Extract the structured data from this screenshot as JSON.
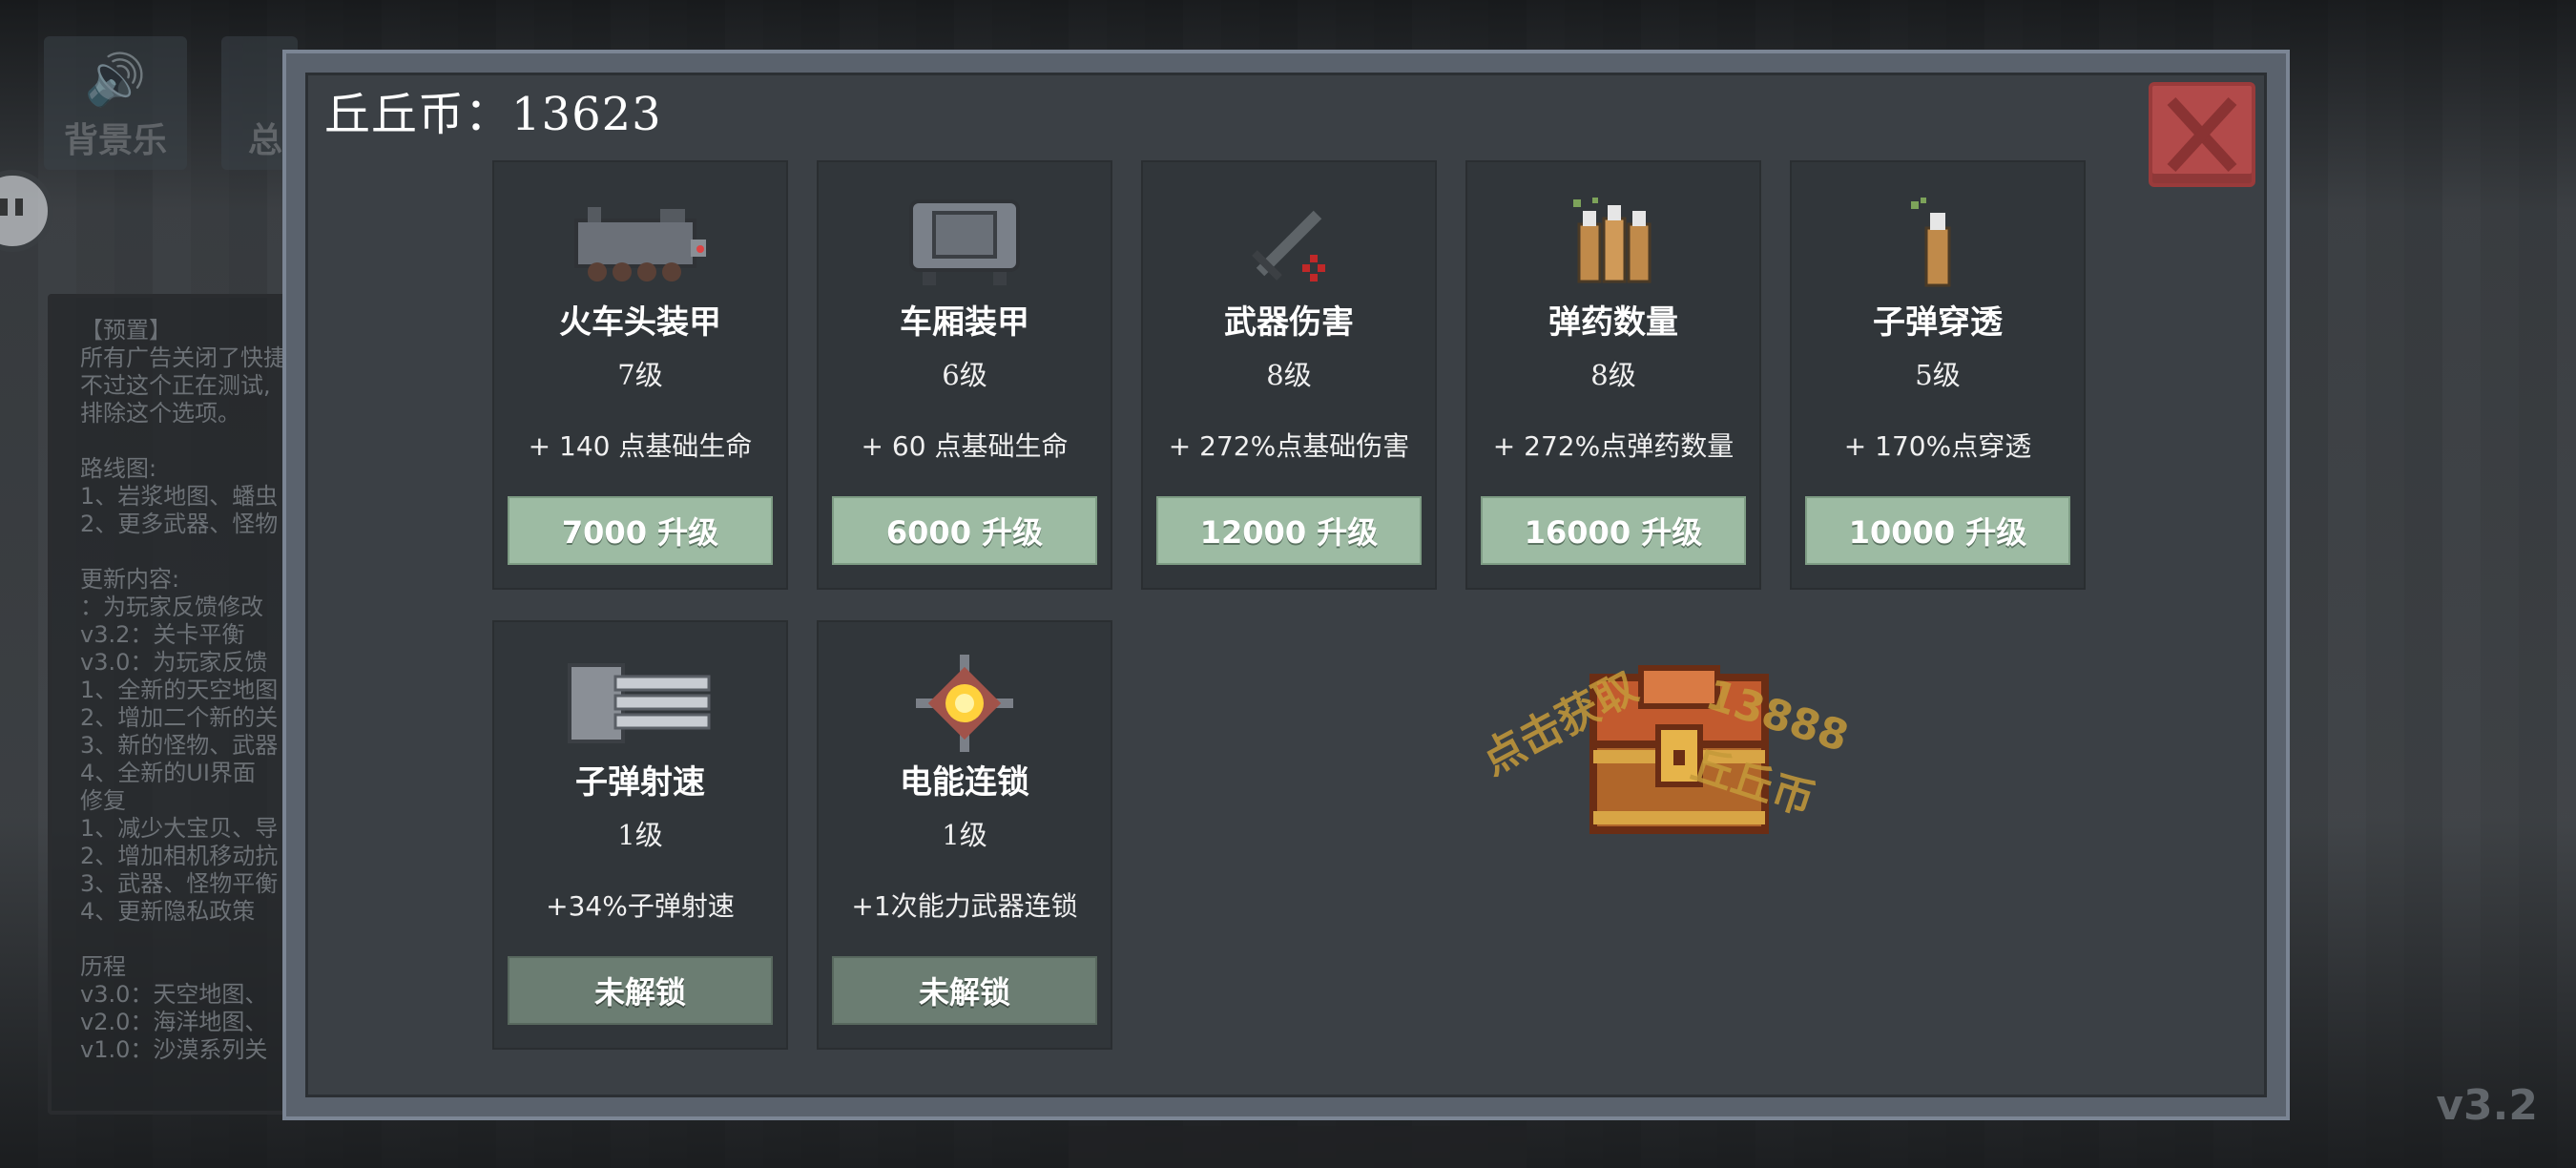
{
  "header": {
    "coin_label": "丘丘币：13623"
  },
  "background": {
    "buttons": [
      {
        "label": "背景乐",
        "icon": "speaker-icon"
      },
      {
        "label": "总"
      }
    ],
    "notes": [
      "【预置】",
      "所有广告关闭了快捷",
      "不过这个正在测试,",
      "排除这个选项。",
      "",
      "路线图:",
      "1、岩浆地图、蟠虫",
      "2、更多武器、怪物",
      "",
      "更新内容:",
      "：为玩家反馈修改",
      "v3.2：关卡平衡",
      "v3.0：为玩家反馈",
      "1、全新的天空地图",
      "2、增加二个新的关",
      "3、新的怪物、武器",
      "4、全新的UI界面",
      "修复",
      "1、减少大宝贝、导",
      "2、增加相机移动抗",
      "3、武器、怪物平衡",
      "4、更新隐私政策",
      "",
      "历程",
      "v3.0：天空地图、",
      "v2.0：海洋地图、",
      "v1.0：沙漠系列关"
    ],
    "version": "v3.2"
  },
  "upgrades": [
    {
      "name": "火车头装甲",
      "level": "7级",
      "desc": "+ 140 点基础生命",
      "button": "7000 升级",
      "locked": false,
      "icon": "locomotive-icon"
    },
    {
      "name": "车厢装甲",
      "level": "6级",
      "desc": "+ 60 点基础生命",
      "button": "6000 升级",
      "locked": false,
      "icon": "carriage-icon"
    },
    {
      "name": "武器伤害",
      "level": "8级",
      "desc": "+ 272%点基础伤害",
      "button": "12000 升级",
      "locked": false,
      "icon": "sword-icon"
    },
    {
      "name": "弹药数量",
      "level": "8级",
      "desc": "+ 272%点弹药数量",
      "button": "16000 升级",
      "locked": false,
      "icon": "ammo-bundle-icon"
    },
    {
      "name": "子弹穿透",
      "level": "5级",
      "desc": "+ 170%点穿透",
      "button": "10000 升级",
      "locked": false,
      "icon": "bullet-icon"
    },
    {
      "name": "子弹射速",
      "level": "1级",
      "desc": "+34%子弹射速",
      "button": "未解锁",
      "locked": true,
      "icon": "gatling-icon"
    },
    {
      "name": "电能连锁",
      "level": "1级",
      "desc": "+1次能力武器连锁",
      "button": "未解锁",
      "locked": true,
      "icon": "energy-orb-icon"
    }
  ],
  "chest": {
    "text_left": "点击获取",
    "text_right_1": "13888",
    "text_right_2": "丘丘币"
  },
  "colors": {
    "upgrade_button": "#9dbba3",
    "locked_button": "#6b7d72",
    "close_button": "#b24a4a",
    "chest_text": "#c59a3a"
  }
}
